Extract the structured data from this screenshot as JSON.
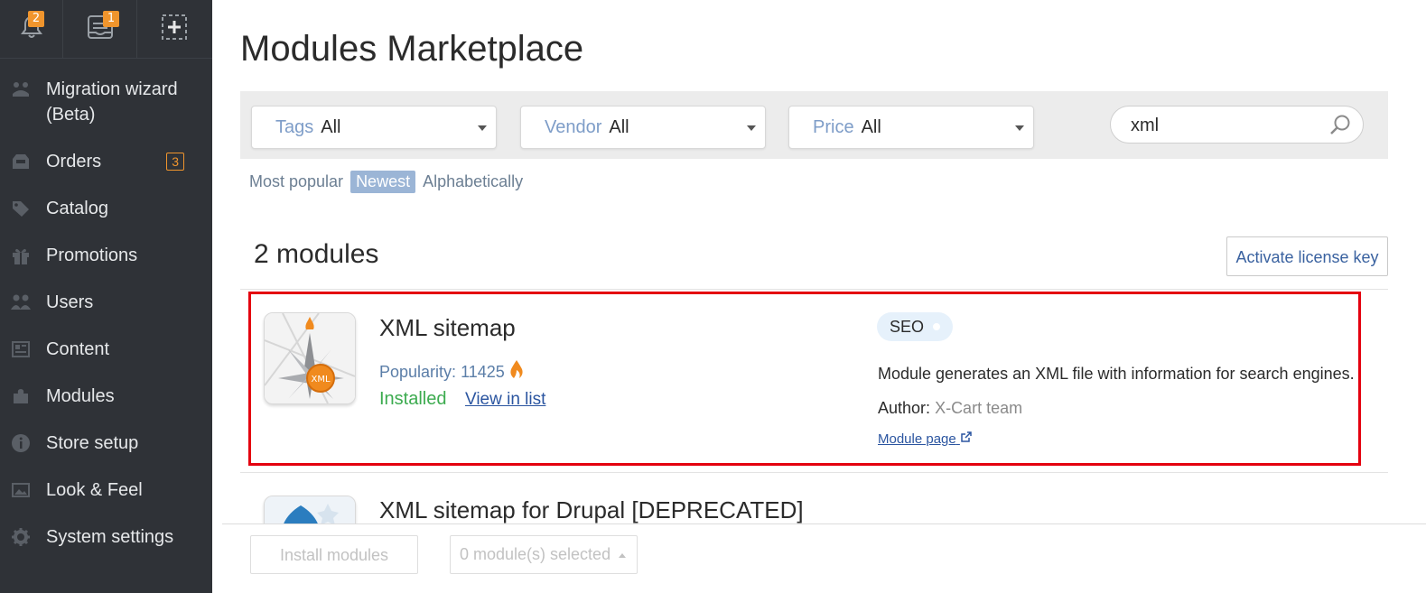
{
  "topbar": {
    "notifications_count": "2",
    "messages_count": "1"
  },
  "sidebar": {
    "items": [
      {
        "label": "Migration wizard (Beta)",
        "icon": "migration-icon"
      },
      {
        "label": "Orders",
        "icon": "orders-icon",
        "count": "3"
      },
      {
        "label": "Catalog",
        "icon": "tag-icon"
      },
      {
        "label": "Promotions",
        "icon": "gift-icon"
      },
      {
        "label": "Users",
        "icon": "users-icon"
      },
      {
        "label": "Content",
        "icon": "content-icon"
      },
      {
        "label": "Modules",
        "icon": "puzzle-icon"
      },
      {
        "label": "Store setup",
        "icon": "info-icon"
      },
      {
        "label": "Look & Feel",
        "icon": "image-icon"
      },
      {
        "label": "System settings",
        "icon": "gear-icon"
      }
    ]
  },
  "page": {
    "title": "Modules Marketplace"
  },
  "filters": {
    "tags": {
      "label": "Tags",
      "value": "All"
    },
    "vendor": {
      "label": "Vendor",
      "value": "All"
    },
    "price": {
      "label": "Price",
      "value": "All"
    },
    "search_value": "xml"
  },
  "sort": {
    "options": [
      "Most popular",
      "Newest",
      "Alphabetically"
    ],
    "active": "Newest"
  },
  "results": {
    "count_label": "2 modules",
    "activate_label": "Activate license key"
  },
  "modules": [
    {
      "title": "XML sitemap",
      "icon_text": "XML",
      "popularity_label": "Popularity:",
      "popularity": "11425",
      "status": "Installed",
      "view_link": "View in list",
      "tag": "SEO",
      "description": "Module generates an XML file with information for search engines.",
      "author_label": "Author:",
      "author": "X-Cart team",
      "module_page": "Module page"
    },
    {
      "title": "XML sitemap for Drupal [DEPRECATED]"
    }
  ],
  "bottom": {
    "install_label": "Install modules",
    "selected_label": "0 module(s) selected"
  },
  "colors": {
    "sidebar_bg": "#2f3237",
    "accent_orange": "#f0952d",
    "link_blue": "#2b55a0",
    "installed_green": "#3cab4f",
    "highlight_red": "#e4000f"
  }
}
